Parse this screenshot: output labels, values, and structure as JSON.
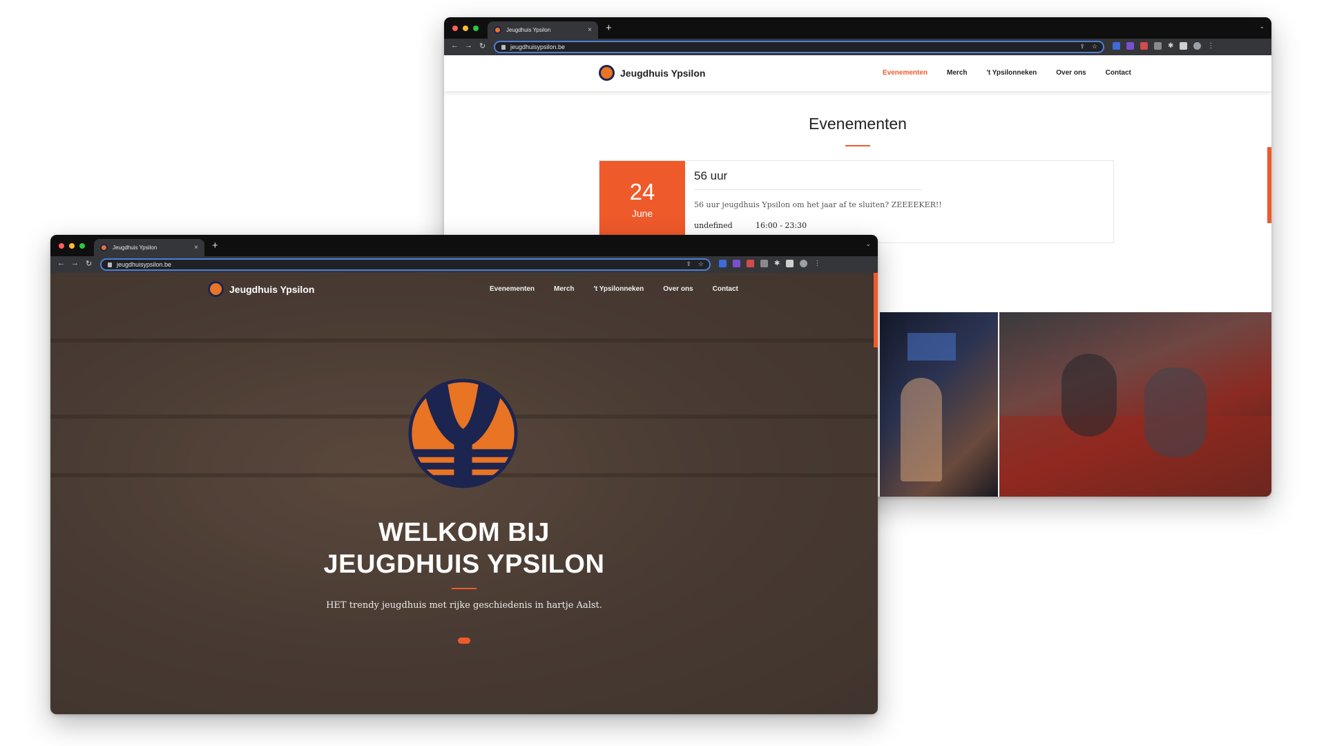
{
  "browser": {
    "tab_title": "Jeugdhuis Ypsilon",
    "tab_close": "×",
    "new_tab": "+",
    "tab_menu": "⌄",
    "url": "jeugdhuisypsilon.be",
    "nav_back": "←",
    "nav_forward": "→",
    "nav_reload": "↻",
    "share_icon": "⇪",
    "star_icon": "☆",
    "puzzle_icon": "✱",
    "menu_icon": "⋮"
  },
  "site": {
    "brand": "Jeugdhuis Ypsilon",
    "nav": [
      "Evenementen",
      "Merch",
      "'t Ypsilonneken",
      "Over ons",
      "Contact"
    ],
    "active_nav": "Evenementen",
    "accent_color": "#ef5a2a",
    "logo_orange": "#e87424",
    "logo_navy": "#1c2450"
  },
  "events_page": {
    "title": "Evenementen",
    "event": {
      "day": "24",
      "month": "June",
      "name": "56 uur",
      "description": "56 uur jeugdhuis Ypsilon om het jaar af te sluiten? ZEEEEKER!!",
      "label": "undefined",
      "time": "16:00 - 23:30"
    }
  },
  "hero": {
    "heading_line1": "WELKOM BIJ",
    "heading_line2": "JEUGDHUIS YPSILON",
    "subtitle": "HET trendy jeugdhuis met rijke geschiedenis in hartje Aalst."
  }
}
